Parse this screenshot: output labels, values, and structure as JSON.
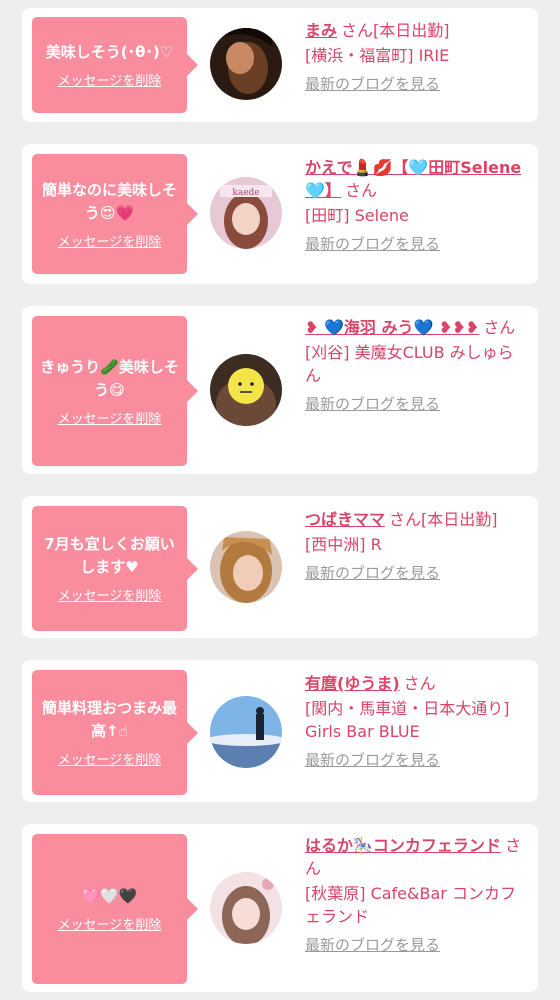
{
  "entries": [
    {
      "message": "美味しそう(･θ･)♡",
      "delete_label": "メッセージを削除",
      "name": "まみ",
      "honorific": "さん",
      "status": "[本日出勤]",
      "shop": "[横浜・福富町] IRIE",
      "blog_label": "最新のブログを見る"
    },
    {
      "message": "簡単なのに美味しそう😍💗",
      "delete_label": "メッセージを削除",
      "name": "かえで💄💋【🩵田町Selene🩵】",
      "honorific": "さん",
      "status": "",
      "shop": "[田町] Selene",
      "blog_label": "最新のブログを見る"
    },
    {
      "message": "きゅうり🥒美味しそう😋",
      "delete_label": "メッセージを削除",
      "name": "❥ 💙海羽 みう💙 ❥❥❥",
      "honorific": "さん",
      "status": "",
      "shop": "[刈谷] 美魔女CLUB みしゅらん",
      "blog_label": "最新のブログを見る"
    },
    {
      "message": "7月も宜しくお願いします♥",
      "delete_label": "メッセージを削除",
      "name": "つばきママ",
      "honorific": "さん",
      "status": "[本日出勤]",
      "shop": "[西中洲] R",
      "blog_label": "最新のブログを見る"
    },
    {
      "message": "簡単料理おつまみ最高↑☝",
      "delete_label": "メッセージを削除",
      "name": "有麿(ゆうま)",
      "honorific": "さん",
      "status": "",
      "shop": "[関内・馬車道・日本大通り] Girls Bar BLUE",
      "blog_label": "最新のブログを見る"
    },
    {
      "message": "🩷🤍🖤",
      "delete_label": "メッセージを削除",
      "name": "はるか🎠コンカフェランド",
      "honorific": "さん",
      "status": "",
      "shop": "[秋葉原] Cafe&Bar コンカフェランド",
      "blog_label": "最新のブログを見る"
    }
  ],
  "colors": {
    "accent": "#d94468",
    "bubble": "#f98d9e",
    "link_gray": "#9a9a9a",
    "background": "#eeeeee"
  }
}
